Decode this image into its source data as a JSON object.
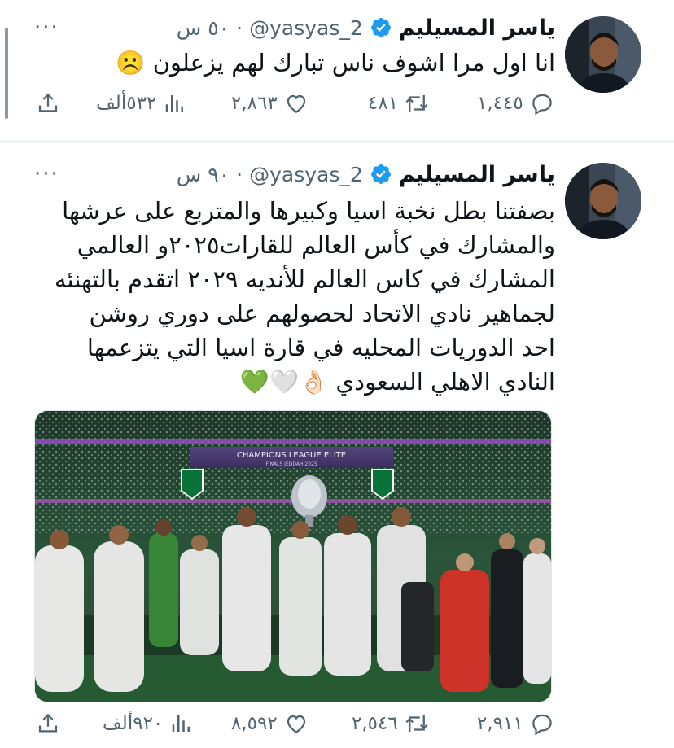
{
  "tweets": [
    {
      "author_name": "ياسر المسيليم",
      "handle": "@yasyas_2",
      "separator": "·",
      "time": "٥٠ س",
      "more": "···",
      "text_lines": [
        "انا اول مرا اشوف ناس تبارك لهم يزعلون ☹️"
      ],
      "stats": {
        "replies": "١,٤٤٥",
        "reposts": "٤٨١",
        "likes": "٢,٨٦٣",
        "views": "٥٣٢ألف"
      },
      "has_thread_line": true
    },
    {
      "author_name": "ياسر المسيليم",
      "handle": "@yasyas_2",
      "separator": "·",
      "time": "٩٠ س",
      "more": "···",
      "text_lines": [
        "بصفتنا بطل نخبة اسيا وكبيرها والمتربع على عرشها",
        "والمشارك في كأس العالم للقارات٢٠٢٥و العالمي",
        "المشارك في كاس العالم للأنديه ٢٠٢٩ اتقدم بالتهنئه",
        "لجماهير نادي الاتحاد لحصولهم على دوري روشن",
        "احد الدوريات المحليه في قارة اسيا التي يتزعمها",
        "النادي الاهلي السعودي 👌🏻🤍💚"
      ],
      "photo": {
        "banner_text": "CHAMPIONS LEAGUE ELITE",
        "banner_subtext": "FINALS JEDDAH 2025"
      },
      "stats": {
        "replies": "٢,٩١١",
        "reposts": "٢,٥٤٦",
        "likes": "٨,٥٩٢",
        "views": "٩٢٠ألف"
      }
    }
  ],
  "colors": {
    "text": "#0f1419",
    "secondary": "#536471",
    "verified": "#1d9bf0",
    "divider": "#eff3f4",
    "ahli_green": "#0a7a3a"
  },
  "icons": [
    "verified-badge-icon",
    "more-icon",
    "reply-icon",
    "repost-icon",
    "like-icon",
    "views-icon",
    "share-icon"
  ]
}
